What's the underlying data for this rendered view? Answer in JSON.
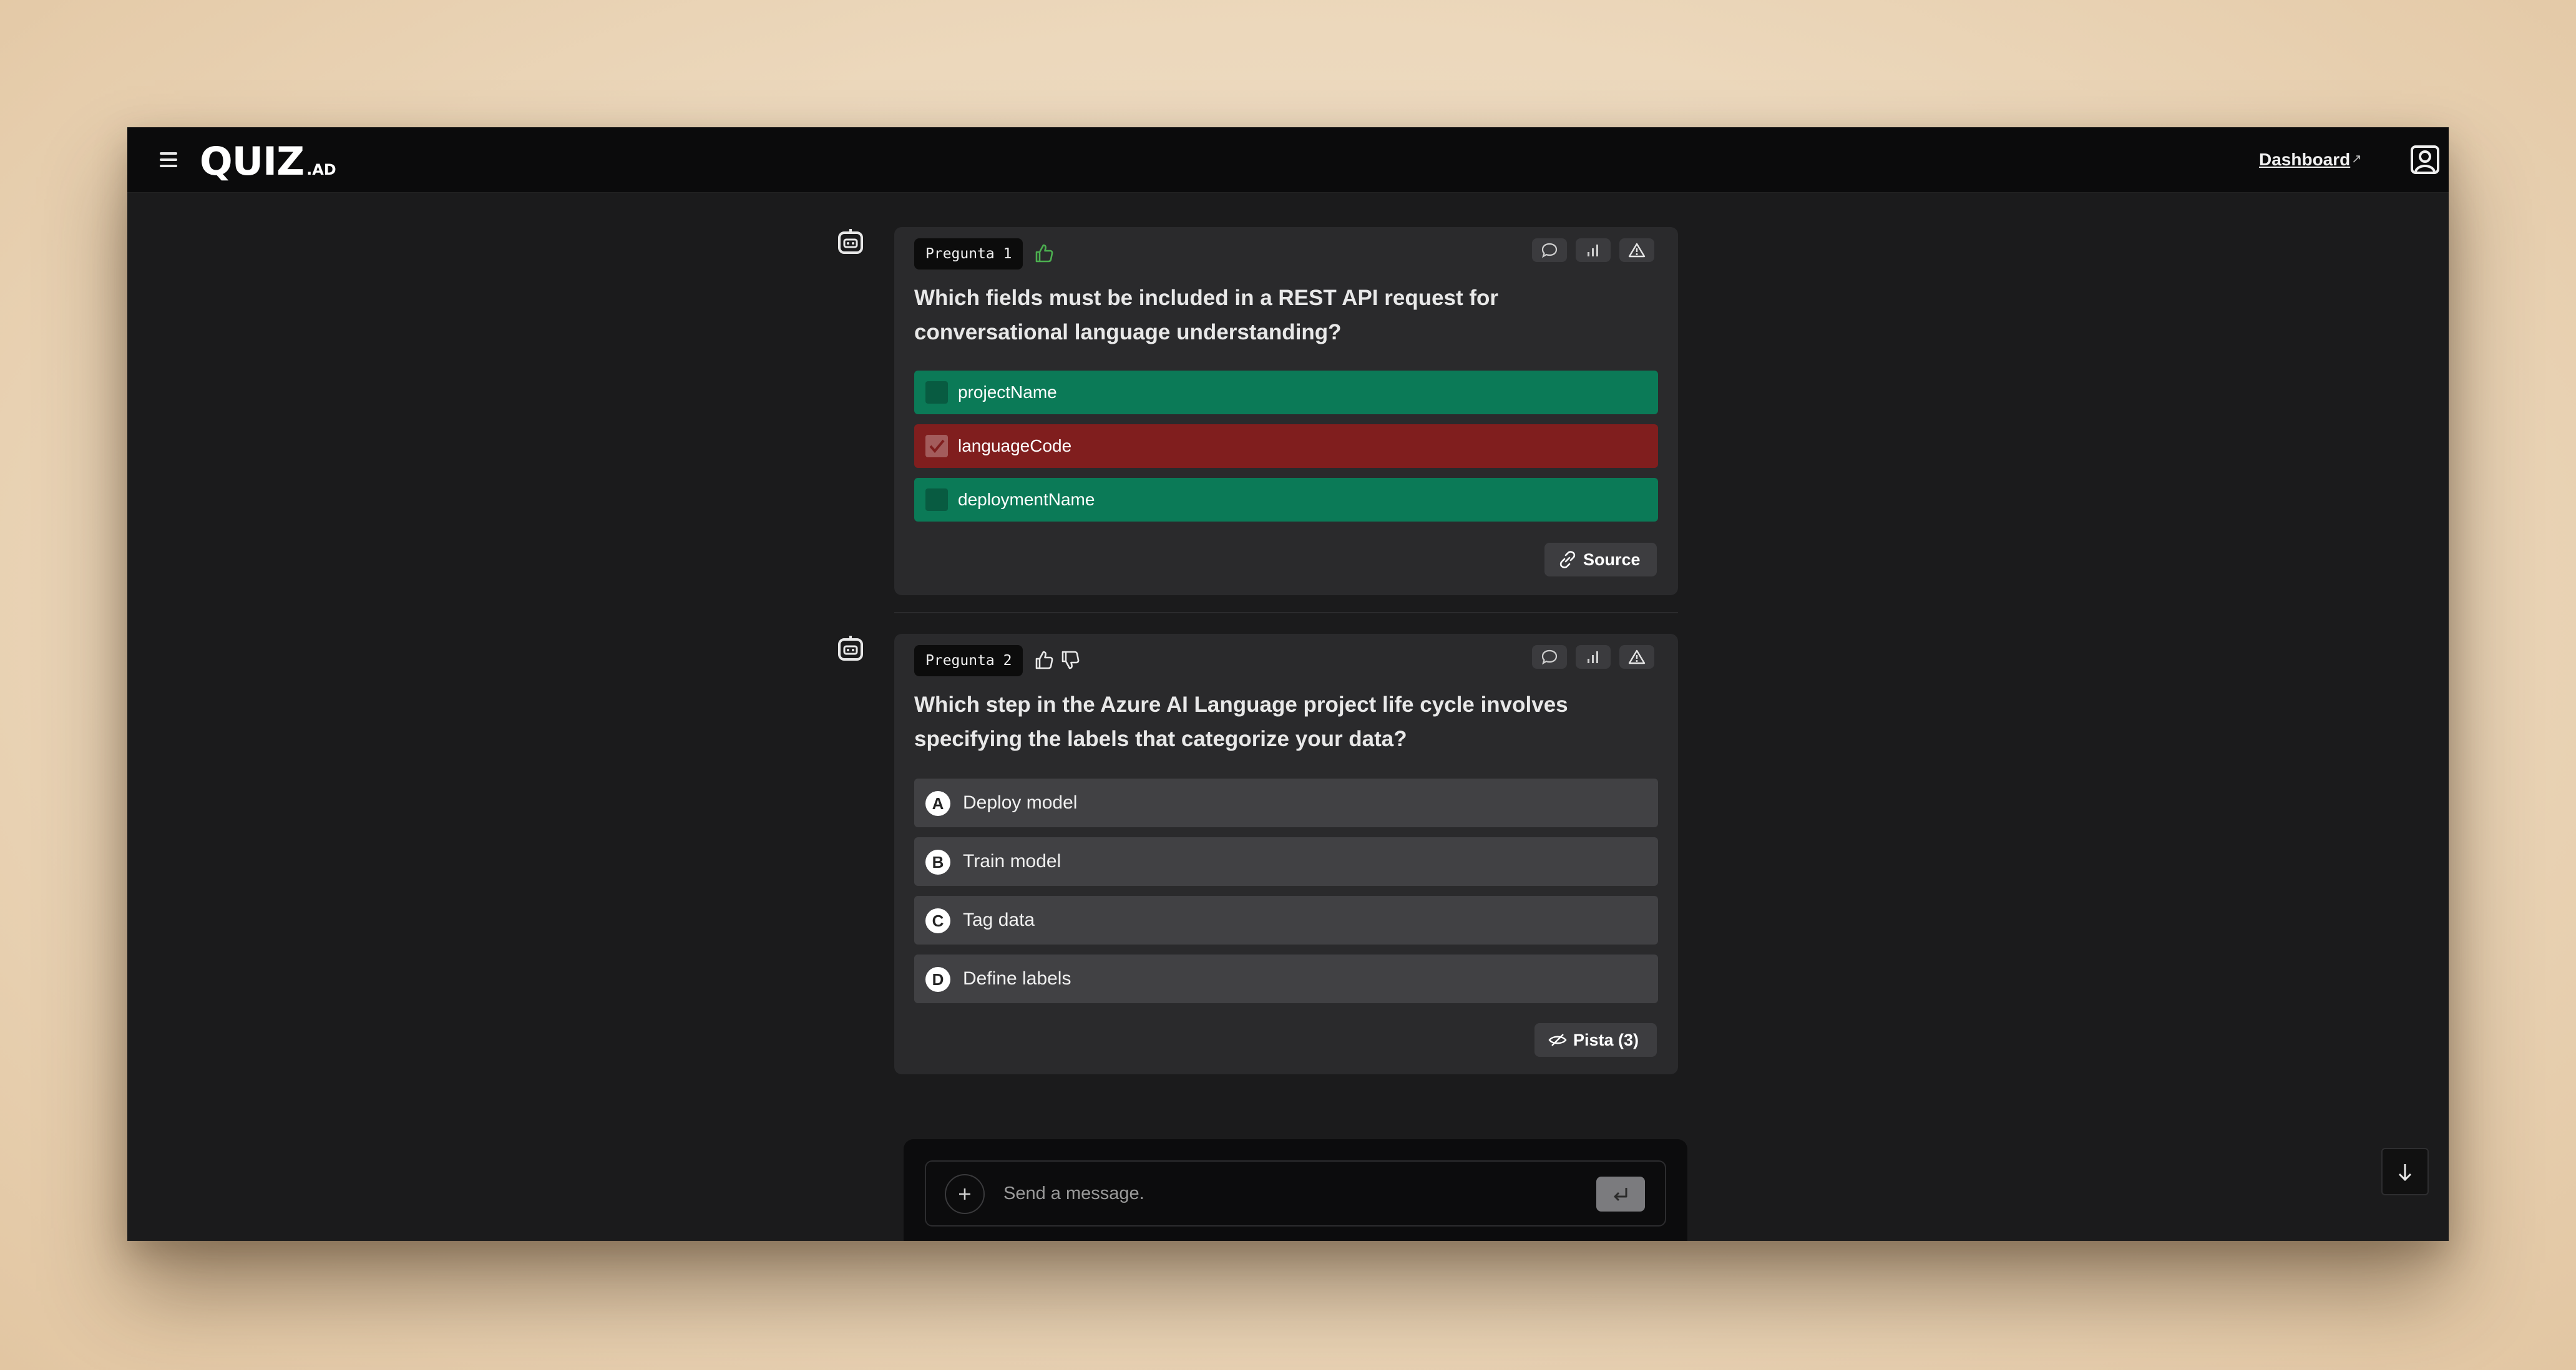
{
  "header": {
    "logo_main": "QUIZ",
    "logo_sub": ".AD",
    "dashboard_label": "Dashboard",
    "dashboard_arrow": "↗"
  },
  "questions": [
    {
      "badge": "Pregunta 1",
      "text": "Which fields must be included in a REST API request for conversational language understanding?",
      "options": [
        {
          "label": "projectName",
          "status": "correct",
          "checked": false
        },
        {
          "label": "languageCode",
          "status": "incorrect",
          "checked": true
        },
        {
          "label": "deploymentName",
          "status": "correct",
          "checked": false
        }
      ],
      "source_label": "Source"
    },
    {
      "badge": "Pregunta 2",
      "text": "Which step in the Azure AI Language project life cycle involves specifying the labels that categorize your data?",
      "options": [
        {
          "letter": "A",
          "label": "Deploy model"
        },
        {
          "letter": "B",
          "label": "Train model"
        },
        {
          "letter": "C",
          "label": "Tag data"
        },
        {
          "letter": "D",
          "label": "Define labels"
        }
      ],
      "hint_label": "Pista (3)"
    }
  ],
  "composer": {
    "placeholder": "Send a message."
  },
  "colors": {
    "correct": "#0b7a57",
    "incorrect": "#801e1e",
    "like": "#4caf50"
  },
  "icons": [
    "menu-icon",
    "user-icon",
    "bot-icon",
    "thumbs-up-icon",
    "thumbs-down-icon",
    "comment-icon",
    "stats-icon",
    "warning-icon",
    "link-icon",
    "hint-icon",
    "plus-icon",
    "enter-icon",
    "arrow-down-icon"
  ]
}
